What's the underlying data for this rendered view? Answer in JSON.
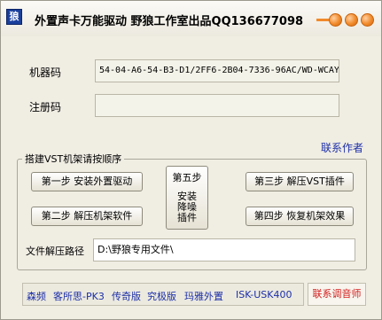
{
  "window": {
    "icon_glyph": "狼",
    "title": "外置声卡万能驱动 野狼工作室出品QQ136677098"
  },
  "fields": {
    "machine_code_label": "机器码",
    "machine_code_value": "54-04-A6-54-B3-D1/2FF6-2B04-7336-96AC/WD-WCAY",
    "register_code_label": "注册码",
    "register_code_value": ""
  },
  "links": {
    "contact_author": "联系作者"
  },
  "group": {
    "title": "搭建VST机架请按顺序"
  },
  "steps": {
    "step1": "第一步 安装外置驱动",
    "step2": "第二步 解压机架软件",
    "step3": "第三步 解压VST插件",
    "step4": "第四步 恢复机架效果",
    "step5_title": "第五步",
    "step5_body": "安装降噪插件"
  },
  "extract": {
    "label": "文件解压路径",
    "value": "D:\\野狼专用文件\\"
  },
  "bottom": {
    "item1": "森频",
    "item2": "客所思-PK3",
    "item3": "传奇版",
    "item4": "究极版",
    "item5": "玛雅外置",
    "item6": "ISK-USK400",
    "contact_tuner": "联系调音师"
  }
}
